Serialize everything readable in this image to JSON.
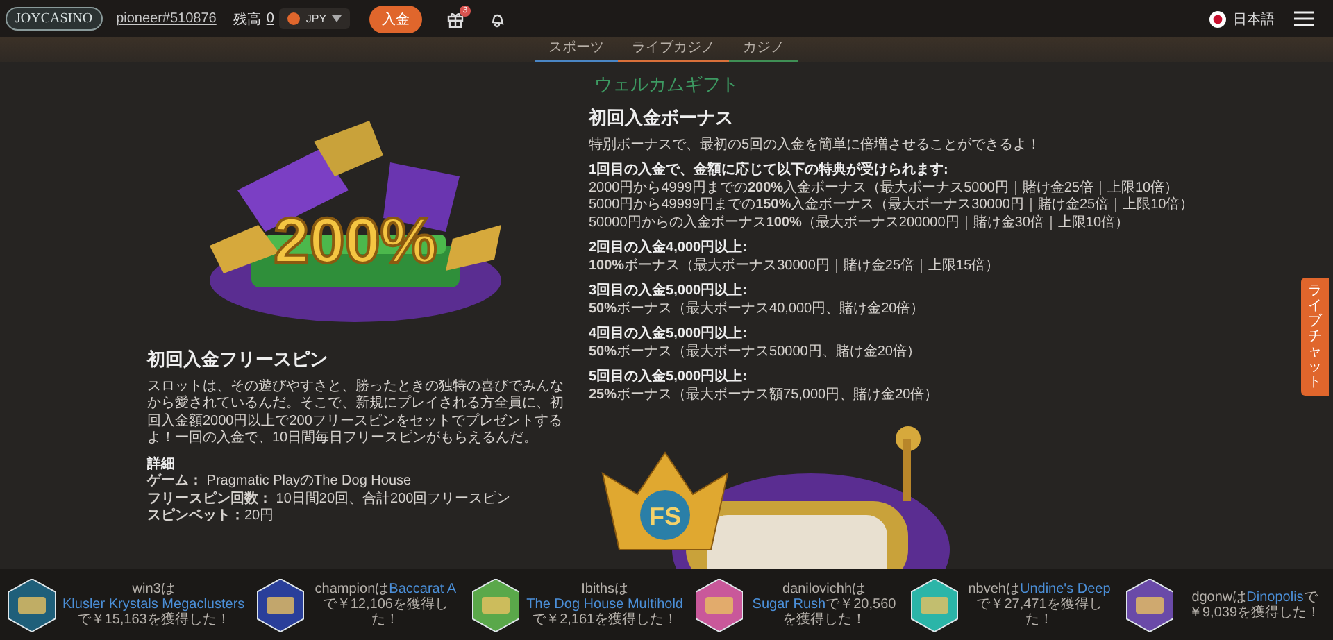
{
  "header": {
    "logo": "JOYCASINO",
    "username": "pioneer#510876",
    "balance_label": "残高",
    "balance": "0",
    "currency": "JPY",
    "deposit_button": "入金",
    "gift_badge": "3",
    "language": "日本語"
  },
  "nav_tabs": [
    {
      "label": "スポーツ",
      "color": "#4a86c5"
    },
    {
      "label": "ライブカジノ",
      "color": "#d9703a"
    },
    {
      "label": "カジノ",
      "color": "#3f8f55"
    }
  ],
  "page_title": "ウェルカムギフト",
  "deposit_bonus": {
    "art_text": "200%",
    "title": "初回入金ボーナス",
    "intro": "特別ボーナスで、最初の5回の入金を簡単に倍増させることができるよ！",
    "groups": [
      {
        "heading": "1回目の入金で、金額に応じて以下の特典が受けられます:",
        "lines": [
          "2000円から4999円までの**200%**入金ボーナス（最大ボーナス5000円｜賭け金25倍｜上限10倍）",
          "5000円から49999円までの**150%**入金ボーナス（最大ボーナス30000円｜賭け金25倍｜上限10倍）",
          "50000円からの入金ボーナス**100%**（最大ボーナス200000円｜賭け金30倍｜上限10倍）"
        ]
      },
      {
        "heading": "2回目の入金4,000円以上:",
        "lines": [
          "**100%**ボーナス（最大ボーナス30000円｜賭け金25倍｜上限15倍）"
        ]
      },
      {
        "heading": "3回目の入金5,000円以上:",
        "lines": [
          "**50%**ボーナス（最大ボーナス40,000円、賭け金20倍）"
        ]
      },
      {
        "heading": "4回目の入金5,000円以上:",
        "lines": [
          "**50%**ボーナス（最大ボーナス50000円、賭け金20倍）"
        ]
      },
      {
        "heading": "5回目の入金5,000円以上:",
        "lines": [
          "**25%**ボーナス（最大ボーナス額75,000円、賭け金20倍）"
        ]
      }
    ]
  },
  "free_spins": {
    "art_text": "FS",
    "title": "初回入金フリースピン",
    "description": "スロットは、その遊びやすさと、勝ったときの独特の喜びでみんなから愛されているんだ。そこで、新規にプレイされる方全員に、初回入金額2000円以上で200フリースピンをセットでプレゼントするよ！一回の入金で、10日間毎日フリースピンがもらえるんだ。",
    "details_heading": "詳細",
    "details": [
      "**ゲーム：** Pragmatic PlayのThe Dog House",
      "**フリースピン回数：** 10日間20回、合計200回フリースピン",
      "**スピンベット：**20円"
    ]
  },
  "winners": [
    {
      "user": "win3は",
      "game": "Klusler Krystals Megaclusters",
      "result": "で￥15,163を獲得した！"
    },
    {
      "user": "championは",
      "game": "Baccarat A",
      "result": "で￥12,106を獲得した！"
    },
    {
      "user": "Ibithsは",
      "game": "The Dog House Multihold",
      "result": "で￥2,161を獲得した！"
    },
    {
      "user": "danilovichhは",
      "game": "Sugar Rush",
      "result": "で￥20,560を獲得した！"
    },
    {
      "user": "nbvehは",
      "game": "Undine's Deep",
      "result": "で￥27,471を獲得した！"
    },
    {
      "user": "dgonwは",
      "game": "Dinopolis",
      "result": "で￥9,039を獲得した！"
    }
  ],
  "side_tab": "ライブチャット"
}
